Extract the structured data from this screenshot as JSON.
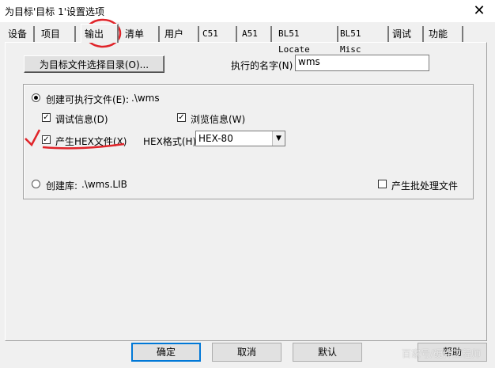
{
  "window": {
    "title": "为目标'目标 1'设置选项",
    "close_glyph": "✕"
  },
  "tabs": [
    {
      "label": "设备"
    },
    {
      "label": "项目"
    },
    {
      "label": "输出",
      "active": true
    },
    {
      "label": "清单"
    },
    {
      "label": "用户"
    },
    {
      "label": "C51"
    },
    {
      "label": "A51"
    },
    {
      "label": "BL51 Locate"
    },
    {
      "label": "BL51 Misc"
    },
    {
      "label": "调试"
    },
    {
      "label": "功能"
    }
  ],
  "output_page": {
    "select_folder_button": "为目标文件选择目录(O)...",
    "exec_name_label": "执行的名字(N)",
    "exec_name_value": "wms",
    "create_executable_label": "创建可执行文件(E):",
    "create_executable_path": ".\\wms",
    "debug_info_label": "调试信息(D)",
    "browse_info_label": "浏览信息(W)",
    "create_hex_label": "产生HEX文件(X)",
    "hex_format_label": "HEX格式(H):",
    "hex_format_value": "HEX-80",
    "create_library_label": "创建库:",
    "create_library_path": ".\\wms.LIB",
    "batch_file_label": "产生批处理文件",
    "debug_info_checked": true,
    "browse_info_checked": true,
    "create_hex_checked": true,
    "batch_file_checked": false,
    "selected_option": "create_executable"
  },
  "footer": {
    "ok": "确定",
    "cancel": "取消",
    "defaults": "默认",
    "help": "帮助"
  },
  "watermark": "百家号/硬件工程师",
  "annotation_colors": {
    "circle": "#e0242a",
    "checkmark": "#e0242a",
    "underline": "#e0242a"
  }
}
